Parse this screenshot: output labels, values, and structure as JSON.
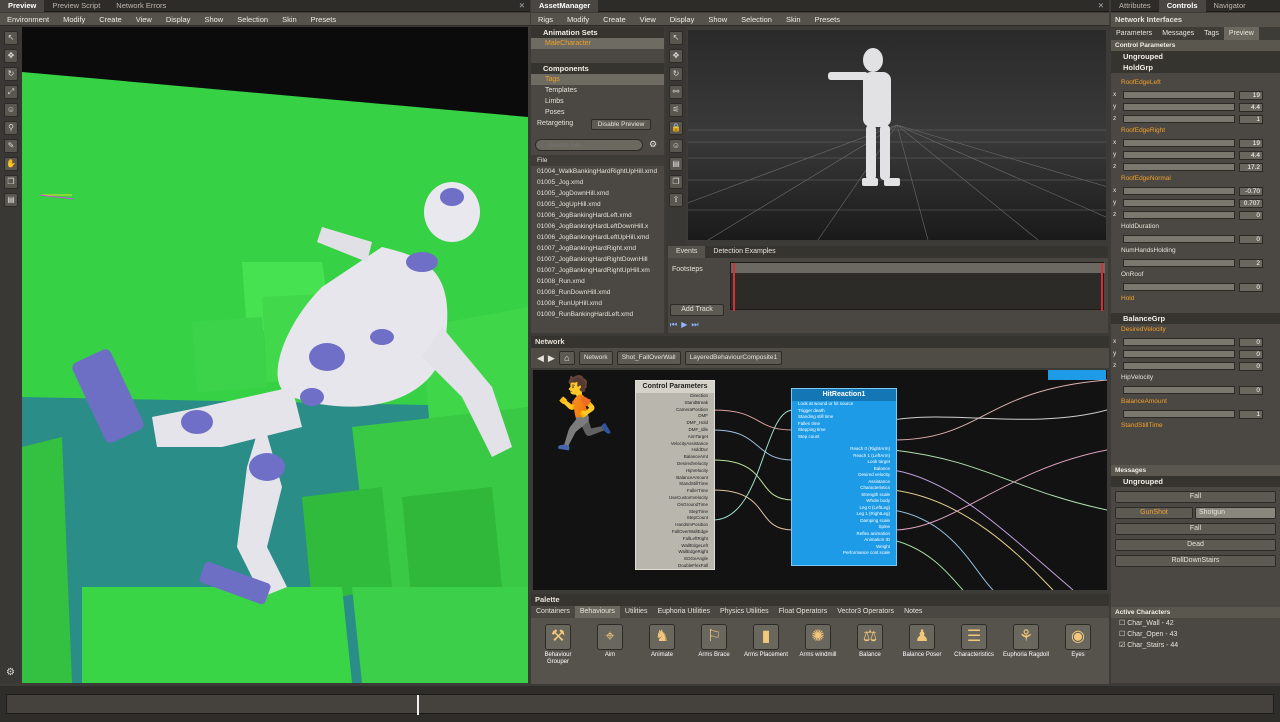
{
  "preview": {
    "tabs": [
      "Preview",
      "Preview Script",
      "Network Errors"
    ],
    "menu": [
      "Environment",
      "Modify",
      "Create",
      "View",
      "Display",
      "Show",
      "Selection",
      "Skin",
      "Presets"
    ]
  },
  "asset_manager": {
    "tab": "AssetManager",
    "menu": [
      "Rigs",
      "Modify",
      "Create",
      "View",
      "Display",
      "Show",
      "Selection",
      "Skin",
      "Presets"
    ],
    "animation_sets_header": "Animation Sets",
    "animation_set": "MaleCharacter",
    "components_header": "Components",
    "components": [
      "Tags",
      "Templates",
      "Limbs",
      "Poses"
    ],
    "retargeting": "Retargeting",
    "disable_preview": "Disable Preview",
    "search_placeholder": "Search File",
    "file_header": "File",
    "files": [
      "01004_WalkBankingHardRightUpHill.xmd",
      "01005_Jog.xmd",
      "01005_JogDownHill.xmd",
      "01005_JogUpHill.xmd",
      "01006_JogBankingHardLeft.xmd",
      "01006_JogBankingHardLeftDownHill.x",
      "01006_JogBankingHardLeftUpHill.xmd",
      "01007_JogBankingHardRight.xmd",
      "01007_JogBankingHardRightDownHill",
      "01007_JogBankingHardRightUpHill.xm",
      "01008_Run.xmd",
      "01008_RunDownHill.xmd",
      "01008_RunUpHill.xmd",
      "01009_RunBankingHardLeft.xmd"
    ],
    "events_tabs": [
      "Events",
      "Detection Examples"
    ],
    "footsteps": "Footsteps",
    "add_track": "Add Track"
  },
  "right_panel": {
    "tabs": [
      "Attributes",
      "Controls",
      "Navigator"
    ],
    "section_title": "Network Interfaces",
    "subtabs": [
      "Parameters",
      "Messages",
      "Tags",
      "Preview"
    ],
    "control_params": "Control Parameters",
    "ungrouped": "Ungrouped",
    "holdgrp": "HoldGrp",
    "roof_edge_left": "RoofEdgeLeft",
    "roof_edge_right": "RoofEdgeRight",
    "roof_edge_normal": "RoofEdgeNormal",
    "hold_duration": "HoldDuration",
    "num_hands_holding": "NumHandsHolding",
    "on_roof": "OnRoof",
    "hold": "Hold",
    "balance_grp": "BalanceGrp",
    "desired_velocity": "DesiredVelocity",
    "hip_velocity": "HipVelocity",
    "balance_amount": "BalanceAmount",
    "stand_still_time": "StandStillTime",
    "axes": [
      "x",
      "y",
      "z"
    ],
    "rel_values": [
      "19",
      "4.4",
      "1",
      "19",
      "4.4",
      "17.2",
      "-0.70",
      "0.707",
      "0",
      "0",
      "2",
      "0",
      "0",
      "0",
      "0",
      "0",
      "1"
    ],
    "messages_header": "Messages",
    "messages_ungrouped": "Ungrouped",
    "msg_fall": "Fall",
    "msg_gunshot": "GunShot",
    "msg_shotgun": "Shotgun",
    "msg_fall2": "Fall",
    "msg_dead": "Dead",
    "msg_rolldown": "RollDownStairs",
    "active_characters": "Active Characters",
    "characters": [
      "Char_Wall - 42",
      "Char_Open - 43",
      "Char_Stairs - 44"
    ]
  },
  "network": {
    "title": "Network",
    "breadcrumb": [
      "Network",
      "Shot_FallOverWall",
      "LayeredBehaviourComposite1"
    ],
    "control_params_node": "Control Parameters",
    "cp_pins": [
      "Direction",
      "StandBreak",
      "CameraPosition",
      "DMF",
      "DMF_Hold",
      "DMF_Idle",
      "AimTarget",
      "VelocityAssistance",
      "HoldDur",
      "BalanceAmt",
      "DesiredVelocity",
      "HipVelocity",
      "BalanceAmount",
      "StandStillTime",
      "FallerTime",
      "UseCustomVelocity",
      "OnGroundTime",
      "StepTime",
      "StepCount",
      "HandsInPosition",
      "FallOverWallEdge",
      "FallLeftRight",
      "WallEdgeLeft",
      "WallEdgeRight",
      "EDGeAngle",
      "DoubleFlexFall"
    ],
    "hit_node": "HitReaction1",
    "hit_inputs": [
      "Look at wound or hit source",
      "Trigger death",
      "Standing still time",
      "Fallen time",
      "Stepping time",
      "Step count"
    ],
    "hit_outputs": [
      "Reach 0 (RightArm)",
      "Reach 1 (LeftArm)",
      "Look target",
      "Balance",
      "Desired velocity",
      "Assistance",
      "Characteristics",
      "Strength scale",
      "Whole body",
      "Leg 0 (LeftLeg)",
      "Leg 1 (RightLeg)",
      "Damping scale",
      "Spine",
      "Reflex animation",
      "Animation ID",
      "Weight",
      "Performance cost scale"
    ]
  },
  "palette": {
    "title": "Palette",
    "tabs": [
      "Containers",
      "Behaviours",
      "Utilities",
      "Euphoria Utilities",
      "Physics Utilities",
      "Float Operators",
      "Vector3 Operators",
      "Notes"
    ],
    "items": [
      "Behaviour Grouper",
      "Aim",
      "Animate",
      "Arms Brace",
      "Arms Placement",
      "Arms windmill",
      "Balance",
      "Balance Poser",
      "Characteristics",
      "Euphoria Ragdoll",
      "Eyes"
    ]
  },
  "colors": {
    "accent": "#f0a02a",
    "green": "#3fd64a",
    "node_blue": "#1e9be6"
  }
}
